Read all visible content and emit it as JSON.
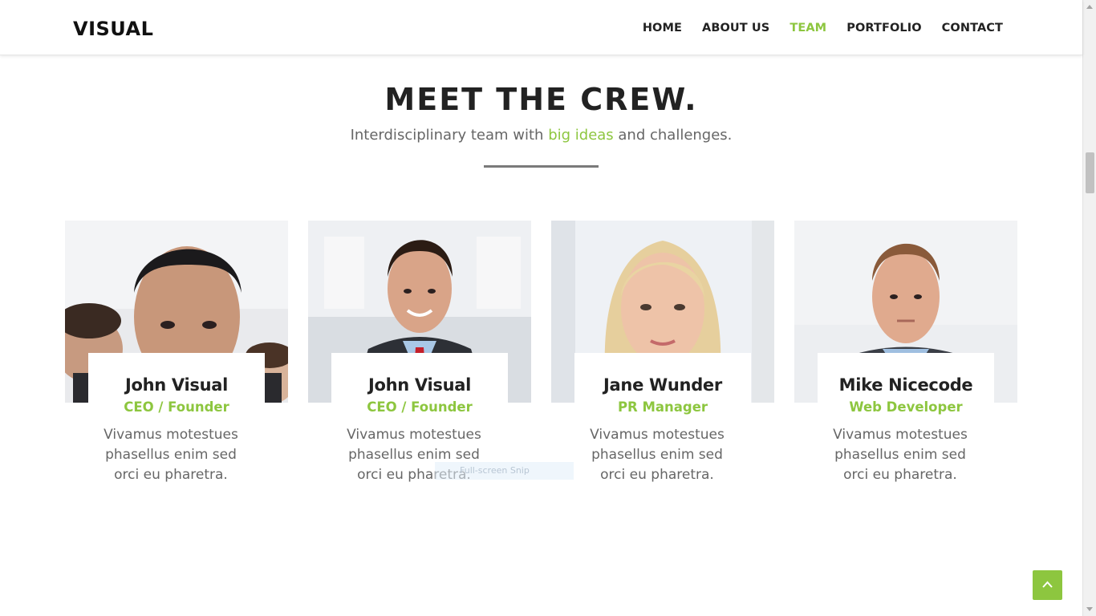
{
  "header": {
    "logo": "VISUAL",
    "nav": [
      {
        "label": "HOME",
        "active": false
      },
      {
        "label": "ABOUT US",
        "active": false
      },
      {
        "label": "TEAM",
        "active": true
      },
      {
        "label": "PORTFOLIO",
        "active": false
      },
      {
        "label": "CONTACT",
        "active": false
      }
    ]
  },
  "section": {
    "title": "MEET THE CREW.",
    "subtitle_before": "Interdisciplinary team with ",
    "subtitle_highlight": "big ideas",
    "subtitle_after": " and challenges."
  },
  "team": [
    {
      "name": "John Visual",
      "role": "CEO / Founder",
      "bio": "Vivamus motestues phasellus enim sed orci eu pharetra."
    },
    {
      "name": "John Visual",
      "role": "CEO / Founder",
      "bio": "Vivamus motestues phasellus enim sed orci eu pharetra."
    },
    {
      "name": "Jane Wunder",
      "role": "PR Manager",
      "bio": "Vivamus motestues phasellus enim sed orci eu pharetra."
    },
    {
      "name": "Mike Nicecode",
      "role": "Web Developer",
      "bio": "Vivamus motestues phasellus enim sed orci eu pharetra."
    }
  ],
  "overlay": {
    "snip_label": "Full-screen Snip"
  },
  "colors": {
    "accent": "#8dc63f",
    "text": "#222222",
    "muted": "#666666"
  },
  "icons": {
    "back_to_top": "chevron-up-icon"
  }
}
